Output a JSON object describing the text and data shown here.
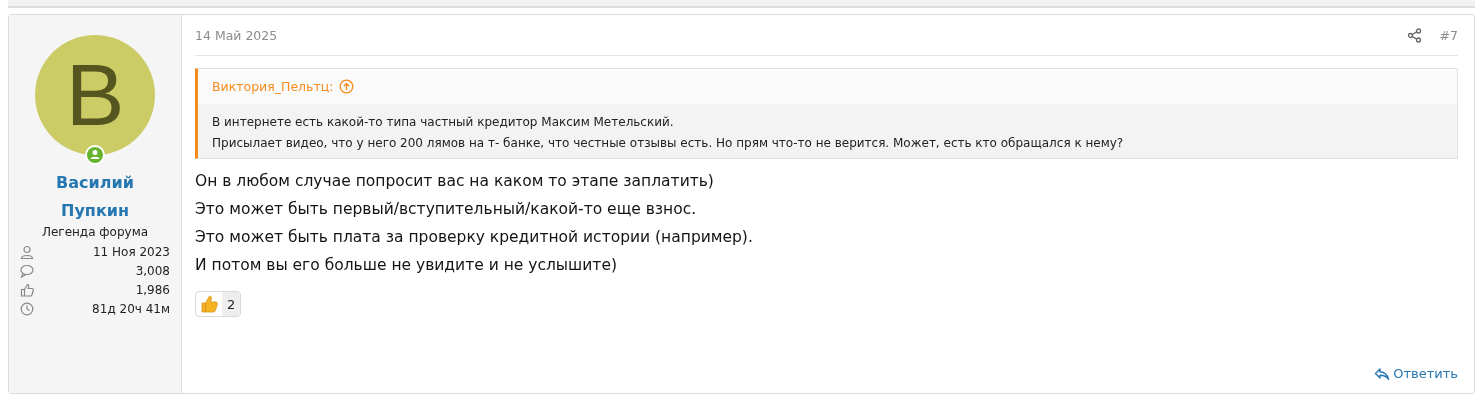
{
  "user": {
    "avatar_letter": "B",
    "online": true,
    "name": "Василий Пупкин",
    "title": "Легенда форума",
    "stats": [
      {
        "kind": "joined",
        "value": "11 Ноя 2023"
      },
      {
        "kind": "messages",
        "value": "3,008"
      },
      {
        "kind": "likes",
        "value": "1,986"
      },
      {
        "kind": "time",
        "value": "81д 20ч 41м"
      }
    ]
  },
  "post": {
    "date": "14 Май 2025",
    "number": "#7",
    "quote": {
      "author": "Виктория_Пельтц:",
      "lines": [
        "В интернете есть какой-то типа частный кредитор Максим Метельский.",
        "Присылает видео, что у него 200 лямов на т- банке, что честные отзывы есть. Но прям что-то не верится. Может, есть кто обращался к нему?"
      ]
    },
    "message": [
      "Он в любом случае попросит вас на каком то этапе заплатить)",
      "Это может быть первый/вступительный/какой-то еще взнос.",
      "Это может быть плата за проверку кредитной истории (например).",
      "И потом вы его больше не увидите и не услышите)"
    ],
    "reactions": [
      {
        "kind": "like",
        "count": "2"
      }
    ],
    "reply": "Ответить"
  }
}
